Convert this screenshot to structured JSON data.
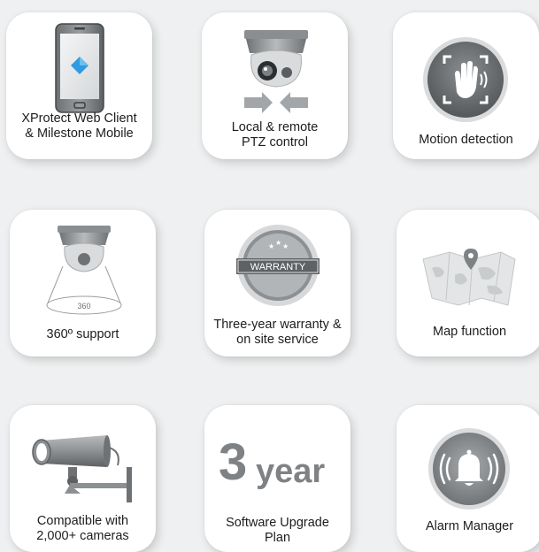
{
  "features": [
    {
      "label": "XProtect Web Client\n& Milestone Mobile",
      "icon": "smartphone-icon"
    },
    {
      "label": "Local & remote\nPTZ control",
      "icon": "ptz-camera-icon"
    },
    {
      "label": "Motion detection",
      "icon": "motion-hand-icon"
    },
    {
      "label": "360º support",
      "icon": "fisheye-camera-icon",
      "icon_text": "360"
    },
    {
      "label": "Three-year warranty &\non site service",
      "icon": "warranty-badge-icon",
      "icon_text": "WARRANTY"
    },
    {
      "label": "Map function",
      "icon": "map-pin-icon"
    },
    {
      "label": "Compatible with\n2,000+ cameras",
      "icon": "bullet-camera-icon"
    },
    {
      "label": "Software Upgrade\nPlan",
      "icon": "three-year-icon",
      "big_number": "3",
      "big_unit": "year"
    },
    {
      "label": "Alarm Manager",
      "icon": "alarm-bell-icon"
    }
  ],
  "colors": {
    "background": "#eef0f1",
    "card": "#ffffff",
    "icon_gray": "#7f8284",
    "phone_screen": "#2f9be0"
  }
}
